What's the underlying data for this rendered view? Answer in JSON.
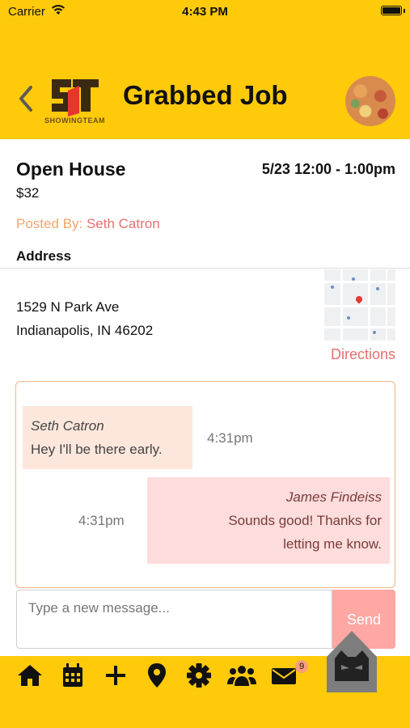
{
  "status_bar": {
    "carrier": "Carrier",
    "time": "4:43 PM"
  },
  "header": {
    "title": "Grabbed Job",
    "logo_text": "SHOWINGTEAM",
    "back_icon": "chevron-left-icon",
    "brand_color": "#FFCA0A"
  },
  "job": {
    "type": "Open House",
    "datetime": "5/23 12:00 - 1:00pm",
    "price": "$32",
    "posted_by_label": "Posted By:",
    "posted_by_name": "Seth Catron",
    "address_heading": "Address",
    "address_line1": "1529 N Park Ave",
    "address_line2": "Indianapolis, IN 46202",
    "directions_label": "Directions"
  },
  "chat": {
    "messages": [
      {
        "sender": "Seth Catron",
        "text": "Hey I'll be there early.",
        "time": "4:31pm",
        "direction": "incoming"
      },
      {
        "sender": "James Findeiss",
        "text_line1": "Sounds good! Thanks for",
        "text_line2": "letting me know.",
        "time": "4:31pm",
        "direction": "outgoing"
      }
    ],
    "input_placeholder": "Type a new message...",
    "send_label": "Send"
  },
  "bottom_nav": {
    "items": [
      "home-icon",
      "calendar-icon",
      "plus-icon",
      "map-pin-icon",
      "gear-icon",
      "users-icon",
      "envelope-icon"
    ],
    "message_badge": "9",
    "fab_icon": "cat-icon"
  },
  "colors": {
    "accent_orange": "#F4A46A",
    "accent_red": "#E86F6F",
    "incoming_bubble": "#FDE7DC",
    "outgoing_bubble": "#FCDDDC",
    "send_button": "#FFA7A3"
  }
}
